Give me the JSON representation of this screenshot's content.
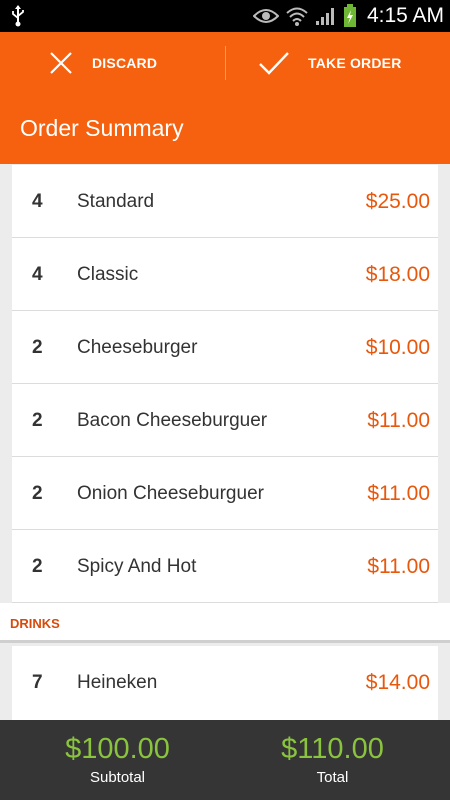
{
  "status_bar": {
    "time": "4:15 AM"
  },
  "action_bar": {
    "discard_label": "DISCARD",
    "take_order_label": "TAKE ORDER",
    "title": "Order Summary"
  },
  "order_items": [
    {
      "qty": "4",
      "name": "Standard",
      "price": "$25.00"
    },
    {
      "qty": "4",
      "name": "Classic",
      "price": "$18.00"
    },
    {
      "qty": "2",
      "name": "Cheeseburger",
      "price": "$10.00"
    },
    {
      "qty": "2",
      "name": "Bacon Cheeseburguer",
      "price": "$11.00"
    },
    {
      "qty": "2",
      "name": "Onion Cheeseburguer",
      "price": "$11.00"
    },
    {
      "qty": "2",
      "name": "Spicy And Hot",
      "price": "$11.00"
    }
  ],
  "drinks": {
    "header": "DRINKS",
    "items": [
      {
        "qty": "7",
        "name": "Heineken",
        "price": "$14.00"
      }
    ]
  },
  "totals": {
    "subtotal_amount": "$100.00",
    "subtotal_label": "Subtotal",
    "total_amount": "$110.00",
    "total_label": "Total"
  },
  "colors": {
    "accent": "#f5610f",
    "price": "#e8580c",
    "total_green": "#8ac43f",
    "bottom_bar": "#353535"
  }
}
